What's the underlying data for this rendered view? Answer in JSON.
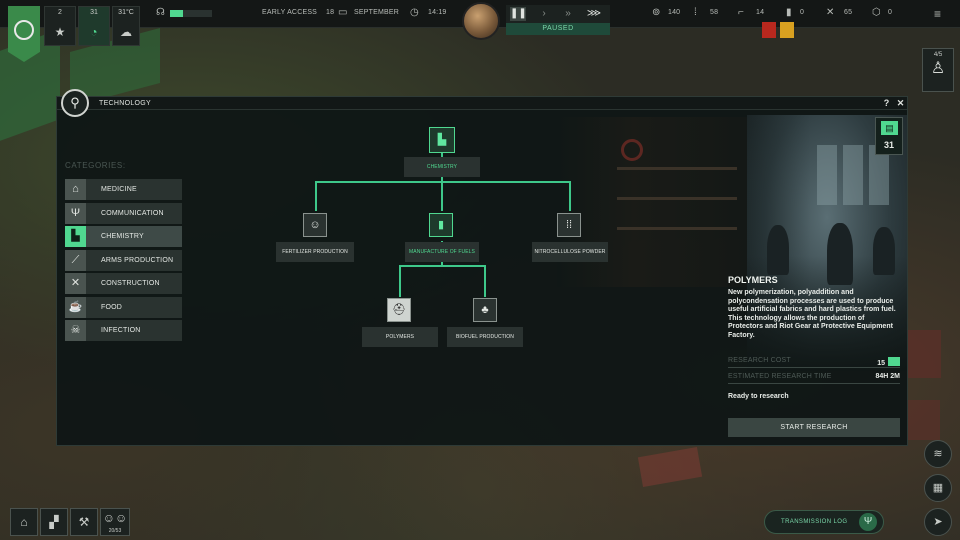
{
  "hud": {
    "stat_1": "2",
    "stat_2": "31",
    "temperature": "31°C",
    "early_access": "EARLY ACCESS",
    "day": "18",
    "month": "SEPTEMBER",
    "time": "14:19",
    "paused": "PAUSED",
    "res_1": "140",
    "res_2": "58",
    "res_3": "14",
    "res_4": "0",
    "res_5": "65",
    "res_6": "0",
    "population": "4/5",
    "shelter_count": "20/53"
  },
  "modal": {
    "title": "TECHNOLOGY",
    "help": "?",
    "close": "✕"
  },
  "categories": {
    "heading": "CATEGORIES:",
    "items": [
      {
        "label": "MEDICINE",
        "icon": "medicine-icon"
      },
      {
        "label": "COMMUNICATION",
        "icon": "antenna-icon"
      },
      {
        "label": "CHEMISTRY",
        "icon": "factory-icon"
      },
      {
        "label": "ARMS PRODUCTION",
        "icon": "rifle-icon"
      },
      {
        "label": "CONSTRUCTION",
        "icon": "tools-icon"
      },
      {
        "label": "FOOD",
        "icon": "food-icon"
      },
      {
        "label": "INFECTION",
        "icon": "skull-icon"
      }
    ]
  },
  "tree": {
    "root": "CHEMISTRY",
    "fertilizer": "FERTILIZER PRODUCTION",
    "fuels": "MANUFACTURE OF FUELS",
    "nitro": "NITROCELLULOSE POWDER",
    "polymers": "POLYMERS",
    "biofuel": "BIOFUEL PRODUCTION"
  },
  "detail": {
    "research_points": "31",
    "name": "POLYMERS",
    "description": "New polymerization, polyaddition and polycondensation processes are used to produce useful artificial fabrics and hard plastics from fuel. This technology allows the production of Protectors and Riot Gear at Protective Equipment Factory.",
    "cost_label": "RESEARCH COST",
    "cost_value": "15",
    "time_label": "ESTIMATED RESEARCH TIME",
    "time_value": "84H 2M",
    "status": "Ready to research",
    "start_button": "START RESEARCH"
  },
  "bottom": {
    "transmission_log": "TRANSMISSION LOG"
  },
  "colors": {
    "accent": "#50d890",
    "panel": "#101716"
  }
}
